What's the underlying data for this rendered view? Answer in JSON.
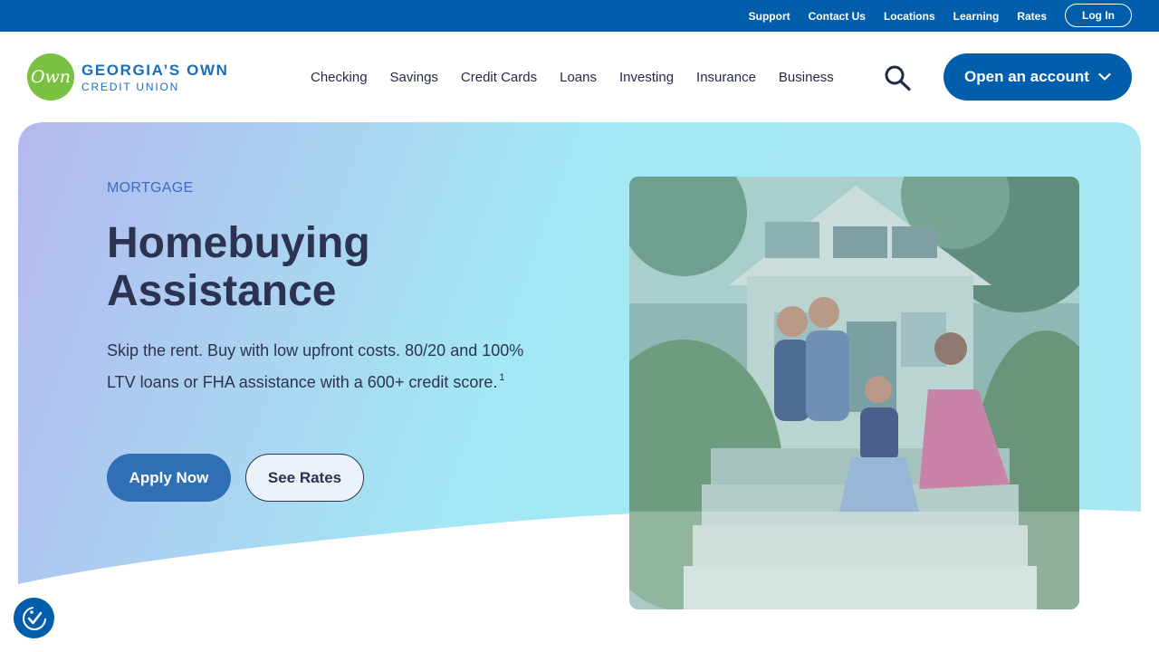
{
  "topbar": {
    "links": [
      "Support",
      "Contact Us",
      "Locations",
      "Learning",
      "Rates"
    ],
    "login_label": "Log In"
  },
  "logo": {
    "mark": "Own",
    "line1": "GEORGIA’S OWN",
    "line2": "CREDIT UNION"
  },
  "nav": {
    "items": [
      "Checking",
      "Savings",
      "Credit Cards",
      "Loans",
      "Investing",
      "Insurance",
      "Business"
    ],
    "search_icon": "search-icon",
    "cta_label": "Open an account"
  },
  "hero": {
    "eyebrow": "MORTGAGE",
    "headline": "Homebuying Assistance",
    "body": "Skip the rent. Buy with low upfront costs. 80/20 and 100% LTV loans or FHA assistance with a 600+ credit score.",
    "footnote": "1",
    "apply_label": "Apply Now",
    "rates_label": "See Rates"
  },
  "colors": {
    "brand_blue": "#005EAB",
    "brand_green": "#7AC143",
    "text_dark": "#2C3350",
    "gradient_start": "#B3B8EE",
    "gradient_end": "#A3E8F4"
  },
  "accessibility": {
    "icon": "accessibility-icon"
  }
}
